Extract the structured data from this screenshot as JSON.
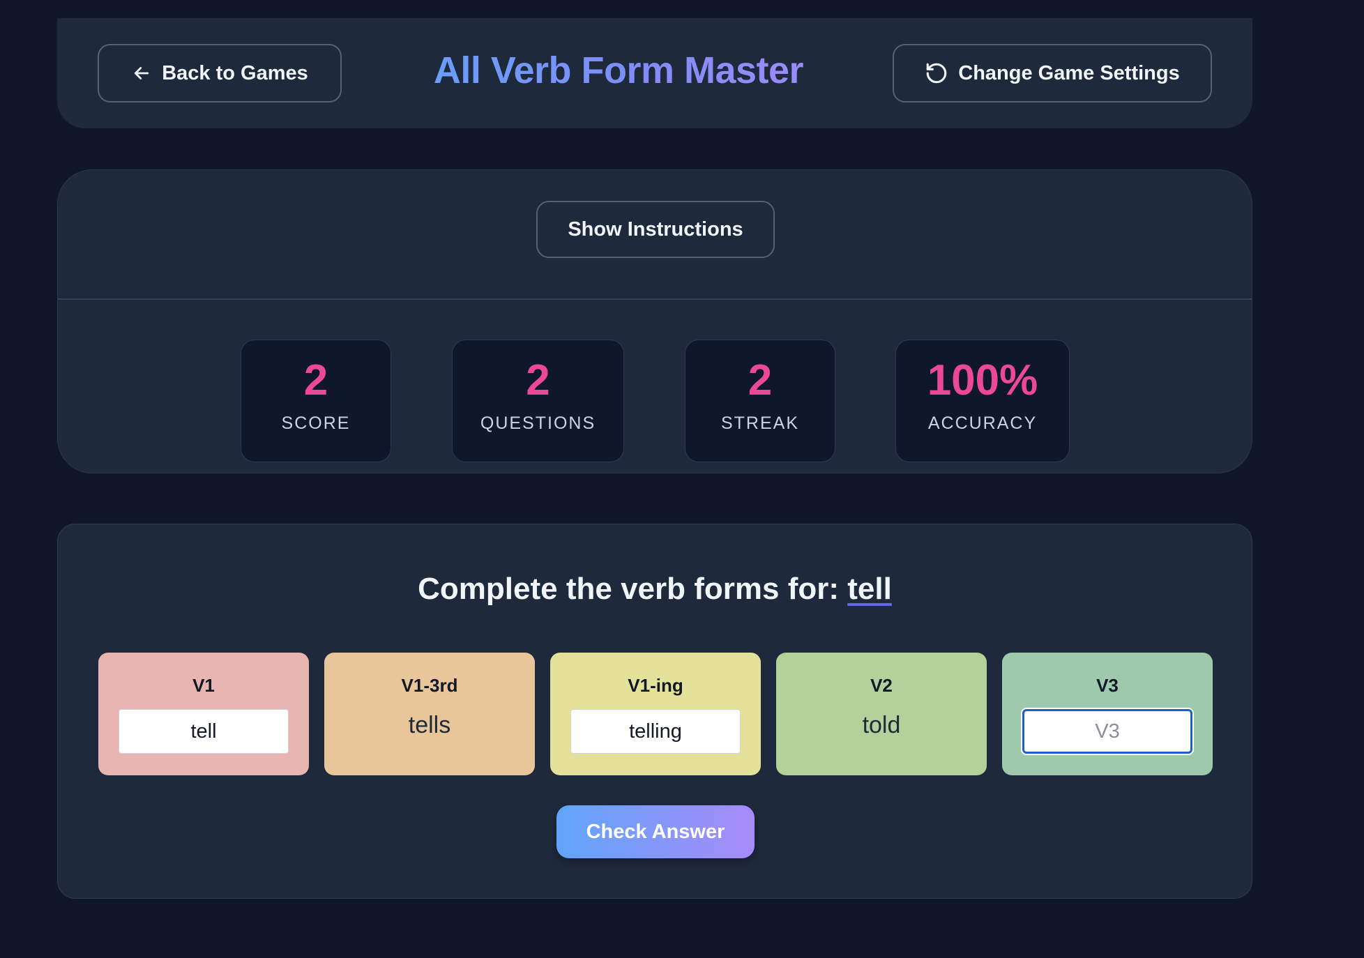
{
  "header": {
    "back_label": "Back to Games",
    "title": "All Verb Form Master",
    "settings_label": "Change Game Settings"
  },
  "stats_panel": {
    "instructions_label": "Show Instructions",
    "stats": [
      {
        "value": "2",
        "label": "SCORE"
      },
      {
        "value": "2",
        "label": "QUESTIONS"
      },
      {
        "value": "2",
        "label": "STREAK"
      },
      {
        "value": "100%",
        "label": "ACCURACY"
      }
    ]
  },
  "game": {
    "prompt_prefix": "Complete the verb forms for: ",
    "verb": "tell",
    "forms": [
      {
        "label": "V1",
        "type": "input",
        "value": "tell",
        "placeholder": "",
        "color": "#e8b4b0"
      },
      {
        "label": "V1-3rd",
        "type": "static",
        "value": "tells",
        "color": "#e9c59a"
      },
      {
        "label": "V1-ing",
        "type": "input",
        "value": "telling",
        "placeholder": "",
        "color": "#e4e19a"
      },
      {
        "label": "V2",
        "type": "static",
        "value": "told",
        "color": "#b3d29b"
      },
      {
        "label": "V3",
        "type": "input",
        "value": "",
        "placeholder": "V3",
        "color": "#9ec9ac"
      }
    ],
    "check_label": "Check Answer"
  },
  "colors": {
    "background": "#0f1729",
    "card": "#1e293b",
    "stat_value": "#ec4899",
    "title_gradient_start": "#60a5fa",
    "title_gradient_end": "#a78bfa"
  }
}
